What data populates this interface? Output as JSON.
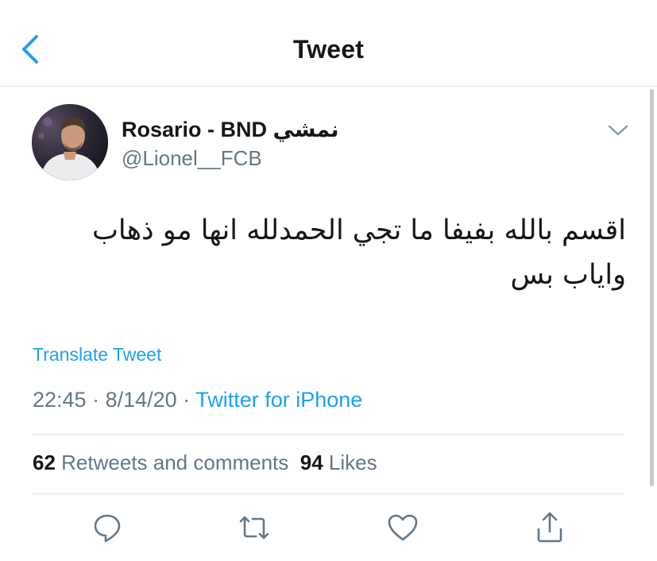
{
  "header": {
    "title": "Tweet",
    "back_icon": "chevron-left-icon"
  },
  "colors": {
    "accent": "#1da1f2",
    "text": "#14171a",
    "secondary": "#657786",
    "divider": "#dfe3e7"
  },
  "tweet": {
    "display_name": "Rosario - BND نمشي",
    "handle": "@Lionel__FCB",
    "text": "اقسم بالله بفيفا ما تجي الحمدلله انها مو ذهاب واياب بس",
    "translate_label": "Translate Tweet",
    "time": "22:45",
    "date": "8/14/20",
    "source": "Twitter for iPhone",
    "separator": "·"
  },
  "stats": {
    "retweets_count": "62",
    "retweets_label": "Retweets and comments",
    "likes_count": "94",
    "likes_label": "Likes"
  },
  "actions": [
    {
      "icon": "reply-icon"
    },
    {
      "icon": "retweet-icon"
    },
    {
      "icon": "like-icon"
    },
    {
      "icon": "share-icon"
    }
  ]
}
